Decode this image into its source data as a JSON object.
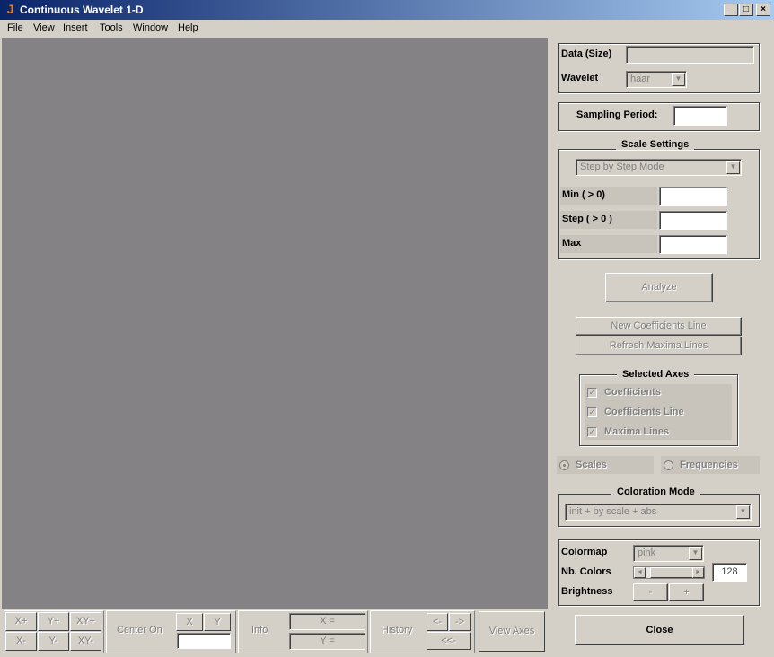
{
  "window": {
    "title": "Continuous Wavelet 1-D"
  },
  "menu": [
    "File",
    "View",
    "Insert",
    "Tools",
    "Window",
    "Help"
  ],
  "data_panel": {
    "data_label": "Data  (Size)",
    "data_value": "",
    "wavelet_label": "Wavelet",
    "wavelet_value": "haar"
  },
  "sampling": {
    "label": "Sampling Period:",
    "value": ""
  },
  "scale": {
    "title": "Scale Settings",
    "mode": "Step by Step Mode",
    "min_label": "Min  ( > 0)",
    "step_label": "Step ( > 0 )",
    "max_label": "Max",
    "min_value": "",
    "step_value": "",
    "max_value": ""
  },
  "actions": {
    "analyze": "Analyze",
    "new_coef_line": "New Coefficients Line",
    "refresh_maxima": "Refresh Maxima Lines"
  },
  "selected_axes": {
    "title": "Selected Axes",
    "items": [
      "Coefficients",
      "Coefficients Line",
      "Maxima Lines"
    ]
  },
  "radios": {
    "scales": "Scales",
    "frequencies": "Frequencies"
  },
  "coloration": {
    "title": "Coloration Mode",
    "mode": "init + by scale + abs"
  },
  "colormap": {
    "colormap_label": "Colormap",
    "colormap_value": "pink",
    "nb_colors_label": "Nb. Colors",
    "nb_colors_value": "128",
    "brightness_label": "Brightness",
    "minus": "-",
    "plus": "+"
  },
  "close": "Close",
  "toolbar": {
    "xplus": "X+",
    "yplus": "Y+",
    "xyplus": "XY+",
    "xminus": "X-",
    "yminus": "Y-",
    "xyminus": "XY-",
    "center_on": "Center On",
    "x": "X",
    "y": "Y",
    "center_value": "",
    "info": "Info",
    "x_eq": "X =",
    "y_eq": "Y =",
    "history": "History",
    "back": "<-",
    "fwd": "->",
    "first": "<<-",
    "view_axes": "View Axes"
  },
  "colors": {
    "plot_bg": "#858286",
    "title_bar": "#0a246a",
    "face": "#d4d0c8"
  }
}
